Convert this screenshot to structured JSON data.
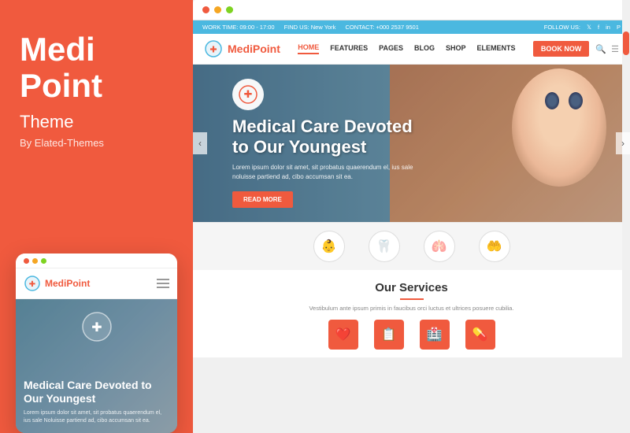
{
  "left": {
    "title_line1": "Medi",
    "title_line2": "Point",
    "subtitle": "Theme",
    "by": "By Elated-Themes",
    "mobile": {
      "logo_medi": "Medi",
      "logo_point": "Point",
      "hero_title": "Medical Care Devoted to Our Youngest",
      "hero_text": "Lorem ipsum dolor sit amet, sit probatus quaerendum el, ius sale Noluisse partiend ad, cibo accumsan sit ea."
    }
  },
  "browser": {
    "info_bar": {
      "work_time": "WORK TIME: 09:00 - 17:00",
      "find_us": "FIND US: New York",
      "contact": "CONTACT: +000 2537 9501",
      "follow": "FOLLOW US:"
    },
    "nav": {
      "logo_medi": "Medi",
      "logo_point": "Point",
      "links": [
        "HOME",
        "FEATURES",
        "PAGES",
        "BLOG",
        "SHOP",
        "ELEMENTS"
      ],
      "book_btn": "BOOK NOW"
    },
    "hero": {
      "title_line1": "Medical Care Devoted",
      "title_line2": "to Our Youngest",
      "desc": "Lorem ipsum dolor sit amet, sit probatus quaerendum el, ius sale noluisse partiend ad, cibo accumsan sit ea.",
      "read_more": "READ MORE"
    },
    "service_icons": [
      "👶",
      "🦷",
      "🫁",
      "🤝"
    ],
    "services": {
      "title": "Our Services",
      "desc": "Vestibulum ante ipsum primis in faucibus orci luctus et ultrices posuere cubilia.",
      "icons": [
        "❤️",
        "📋",
        "🏥",
        "💊"
      ]
    }
  }
}
